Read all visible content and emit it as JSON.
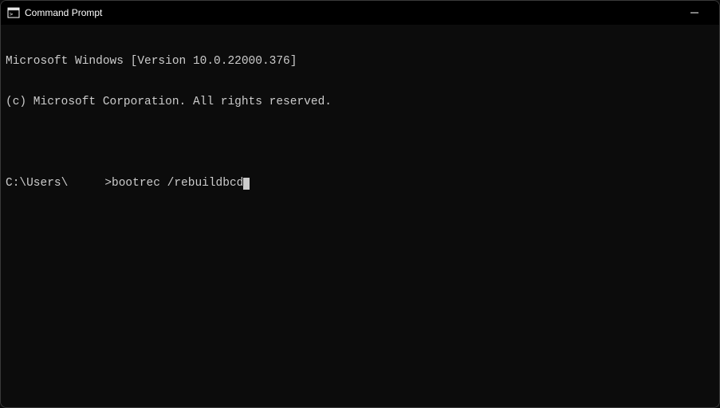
{
  "window": {
    "title": "Command Prompt"
  },
  "terminal": {
    "header_line1": "Microsoft Windows [Version 10.0.22000.376]",
    "header_line2": "(c) Microsoft Corporation. All rights reserved.",
    "prompt_prefix": "C:\\Users\\",
    "prompt_username_hidden": "",
    "prompt_suffix": ">",
    "command": "bootrec /rebuildbcd"
  }
}
